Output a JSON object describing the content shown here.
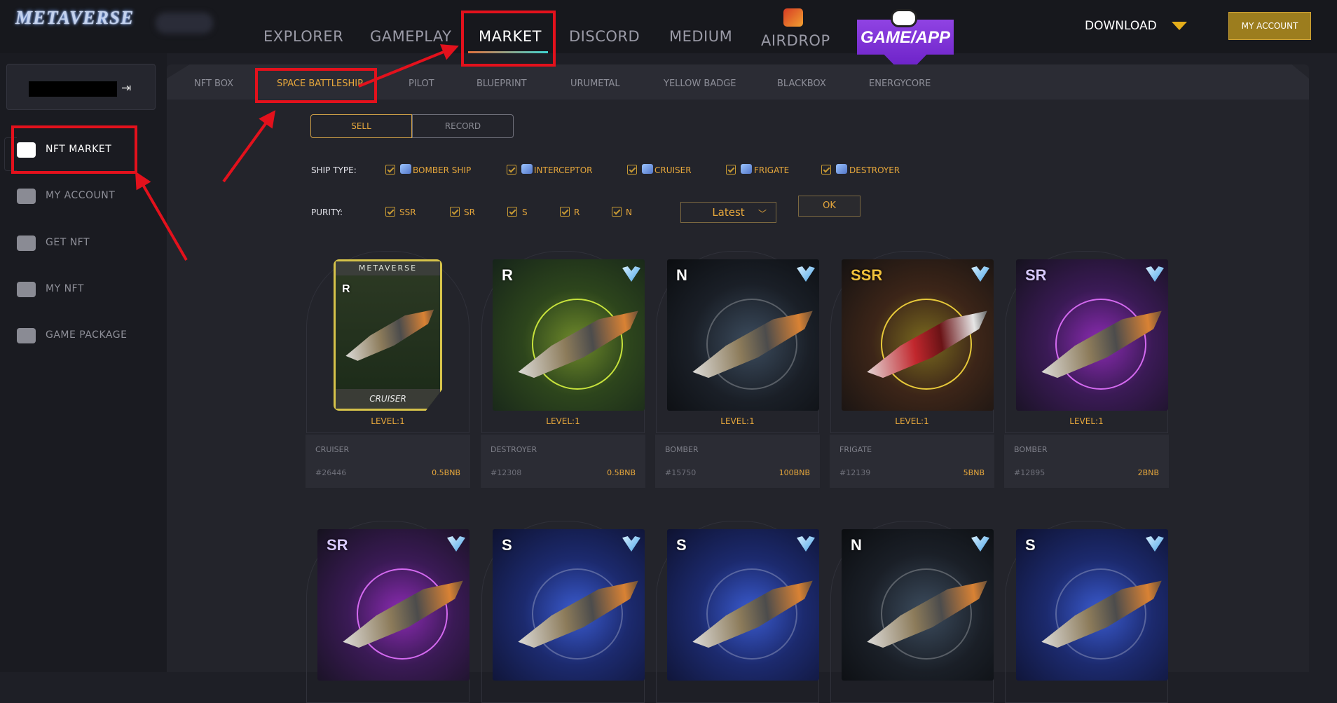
{
  "header": {
    "logo": "METAVERSE",
    "nav": [
      {
        "label": "EXPLORER"
      },
      {
        "label": "GAMEPLAY"
      },
      {
        "label": "MARKET"
      },
      {
        "label": "DISCORD"
      },
      {
        "label": "MEDIUM"
      },
      {
        "label": "AIRDROP"
      }
    ],
    "game_app": "GAME/APP",
    "download": "DOWNLOAD",
    "my_account": "MY ACCOUNT"
  },
  "sidebar": {
    "items": [
      {
        "label": "NFT MARKET",
        "icon": "cart-icon"
      },
      {
        "label": "MY ACCOUNT",
        "icon": "mail-icon"
      },
      {
        "label": "GET NFT",
        "icon": "wallet-icon"
      },
      {
        "label": "MY NFT",
        "icon": "image-icon"
      },
      {
        "label": "GAME PACKAGE",
        "icon": "gamepad-icon"
      }
    ]
  },
  "subtabs": [
    "NFT BOX",
    "SPACE BATTLESHIP",
    "PILOT",
    "BLUEPRINT",
    "URUMETAL",
    "YELLOW BADGE",
    "BLACKBOX",
    "ENERGYCORE"
  ],
  "toggle": {
    "sell": "SELL",
    "record": "RECORD"
  },
  "filters": {
    "ship_type_label": "SHIP TYPE:",
    "ship_types": [
      "BOMBER SHIP",
      "INTERCEPTOR",
      "CRUISER",
      "FRIGATE",
      "DESTROYER"
    ],
    "purity_label": "PURITY:",
    "purities": [
      "SSR",
      "SR",
      "S",
      "R",
      "N"
    ],
    "sort": "Latest",
    "ok": "OK"
  },
  "cards": [
    {
      "rarity": "R",
      "level": "LEVEL:1",
      "type": "CRUISER",
      "id": "#26446",
      "price": "0.5BNB",
      "frame_title": "METAVERSE",
      "frame_label": "CRUISER"
    },
    {
      "rarity": "R",
      "level": "LEVEL:1",
      "type": "DESTROYER",
      "id": "#12308",
      "price": "0.5BNB"
    },
    {
      "rarity": "N",
      "level": "LEVEL:1",
      "type": "BOMBER",
      "id": "#15750",
      "price": "100BNB"
    },
    {
      "rarity": "SSR",
      "level": "LEVEL:1",
      "type": "FRIGATE",
      "id": "#12139",
      "price": "5BNB"
    },
    {
      "rarity": "SR",
      "level": "LEVEL:1",
      "type": "BOMBER",
      "id": "#12895",
      "price": "2BNB"
    }
  ],
  "cards_row2": [
    {
      "rarity": "SR"
    },
    {
      "rarity": "S"
    },
    {
      "rarity": "S"
    },
    {
      "rarity": "N"
    },
    {
      "rarity": "S"
    }
  ],
  "colors": {
    "accent": "#e6a73c",
    "annotation": "#e3111c",
    "gameapp": "#7b2fd6"
  }
}
